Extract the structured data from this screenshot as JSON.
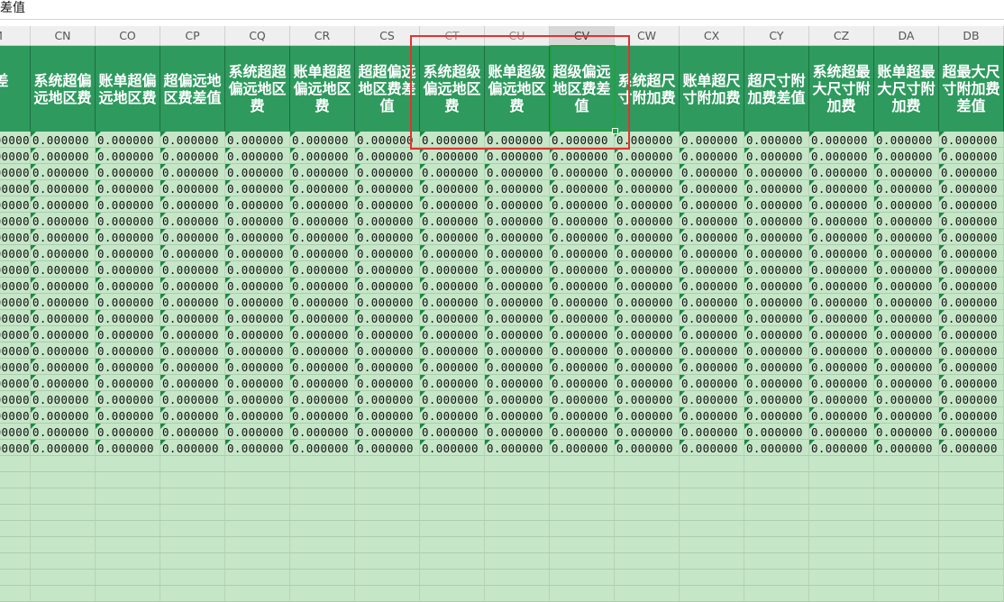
{
  "formula_bar": {
    "text": "差值"
  },
  "columns": [
    {
      "letter": "M",
      "header": "远地费差值"
    },
    {
      "letter": "CN",
      "header": "系统超偏远地区费"
    },
    {
      "letter": "CO",
      "header": "账单超偏远地区费"
    },
    {
      "letter": "CP",
      "header": "超偏远地区费差值"
    },
    {
      "letter": "CQ",
      "header": "系统超超偏远地区费"
    },
    {
      "letter": "CR",
      "header": "账单超超偏远地区费"
    },
    {
      "letter": "CS",
      "header": "超超偏远地区费差值"
    },
    {
      "letter": "CT",
      "header": "系统超级偏远地区费"
    },
    {
      "letter": "CU",
      "header": "账单超级偏远地区费"
    },
    {
      "letter": "CV",
      "header": "超级偏远地区费差值"
    },
    {
      "letter": "CW",
      "header": "系统超尺寸附加费"
    },
    {
      "letter": "CX",
      "header": "账单超尺寸附加费"
    },
    {
      "letter": "CY",
      "header": "超尺寸附加费差值"
    },
    {
      "letter": "CZ",
      "header": "系统超最大尺寸附加费"
    },
    {
      "letter": "DA",
      "header": "账单超最大尺寸附加费"
    },
    {
      "letter": "DB",
      "header": "超最大尺寸附加费差值"
    }
  ],
  "selection": {
    "active_column": "CV",
    "highlight_columns": [
      "CT",
      "CU",
      "CV"
    ],
    "highlight_color": "#e53131",
    "active_border_color": "#21a040"
  },
  "cell_value": "0.000000",
  "data_row_count": 20,
  "colors": {
    "header_bg": "#2e9a5e",
    "data_bg": "#c6e6c8",
    "error_indicator": "#1a8a40"
  }
}
